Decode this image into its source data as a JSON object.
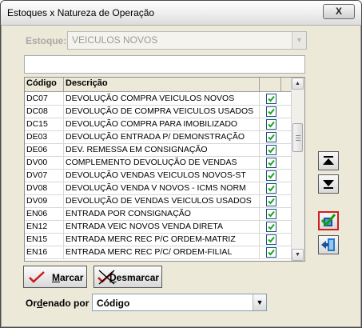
{
  "window": {
    "title": "Estoques x Natureza de Operação",
    "close_label": "X"
  },
  "estoque": {
    "label": "Estoque:",
    "value": "VEICULOS NOVOS"
  },
  "search": {
    "value": ""
  },
  "grid": {
    "headers": {
      "codigo": "Código",
      "descricao": "Descrição"
    },
    "rows": [
      {
        "code": "DC07",
        "desc": "DEVOLUÇÃO COMPRA VEICULOS NOVOS",
        "checked": true
      },
      {
        "code": "DC08",
        "desc": "DEVOLUÇÃO DE COMPRA VEICULOS USADOS",
        "checked": true
      },
      {
        "code": "DC15",
        "desc": "DEVOLUÇÃO COMPRA PARA IMOBILIZADO",
        "checked": true
      },
      {
        "code": "DE03",
        "desc": "DEVOLUÇÃO ENTRADA P/ DEMONSTRAÇÃO",
        "checked": true
      },
      {
        "code": "DE06",
        "desc": "DEV. REMESSA EM CONSIGNAÇÃO",
        "checked": true
      },
      {
        "code": "DV00",
        "desc": "COMPLEMENTO DEVOLUÇÃO DE VENDAS",
        "checked": true
      },
      {
        "code": "DV07",
        "desc": "DEVOLUÇÃO VENDAS VEICULOS NOVOS-ST",
        "checked": true
      },
      {
        "code": "DV08",
        "desc": "DEVOLUÇÃO VENDA V NOVOS - ICMS NORM",
        "checked": true
      },
      {
        "code": "DV09",
        "desc": "DEVOLUÇÃO DE VENDAS VEICULOS USADOS",
        "checked": true
      },
      {
        "code": "EN06",
        "desc": "ENTRADA POR CONSIGNAÇÃO",
        "checked": true
      },
      {
        "code": "EN12",
        "desc": "ENTRADA VEIC NOVOS VENDA DIRETA",
        "checked": true
      },
      {
        "code": "EN15",
        "desc": "ENTRADA  MERC REC P/C ORDEM-MATRIZ",
        "checked": true
      },
      {
        "code": "EN16",
        "desc": "ENTRADA MERC REC P/C/ ORDEM-FILIAL",
        "checked": true
      }
    ]
  },
  "scrollbar": {
    "up_arrow": "▲",
    "down_arrow": "▼"
  },
  "side_buttons": {
    "up_icon": "arrow-up-bar-icon",
    "down_icon": "arrow-down-bar-icon",
    "confirm_icon": "confirm-check-icon",
    "exit_icon": "exit-door-icon"
  },
  "actions": {
    "mark_first": "M",
    "mark_rest": "arcar",
    "unmark_first": "D",
    "unmark_rest": "esmarcar"
  },
  "sort": {
    "label_pre": "Or",
    "label_u": "d",
    "label_post": "enado por :",
    "value": "Código"
  },
  "colors": {
    "window_bg": "#ece9d8",
    "check_green": "#1aa31a",
    "mark_red": "#d01818",
    "confirm_border": "#d02020"
  }
}
